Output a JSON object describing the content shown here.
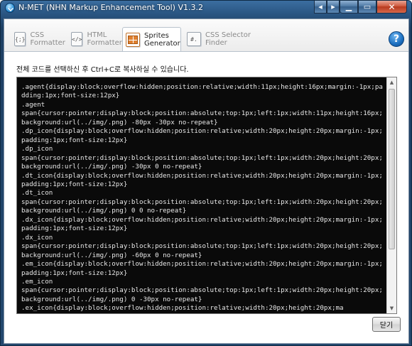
{
  "window": {
    "title": "N-MET (NHN Markup Enhancement Tool) V1.3.2",
    "controls": {
      "back": "◂",
      "forward": "▸",
      "minimize": "▁",
      "maximize": "▭",
      "close": "✕"
    }
  },
  "tabs": [
    {
      "label": "CSS\nFormatter",
      "icon": "css-formatter-icon",
      "glyph": "{;}",
      "active": false
    },
    {
      "label": "HTML\nFormatter",
      "icon": "html-formatter-icon",
      "glyph": "</>",
      "active": false
    },
    {
      "label": "Sprites\nGenerator",
      "icon": "sprites-generator-icon",
      "glyph": "",
      "active": true
    },
    {
      "label": "CSS Selector\nFinder",
      "icon": "css-selector-finder-icon",
      "glyph": "#.",
      "active": false
    }
  ],
  "help": {
    "label": "?"
  },
  "panel": {
    "instruction": "전체 코드를 선택하신 후 Ctrl+C로 복사하실 수 있습니다.",
    "code": ".agent{display:block;overflow:hidden;position:relative;width:11px;height:16px;margin:-1px;padding:1px;font-size:12px}\n.agent\nspan{cursor:pointer;display:block;position:absolute;top:1px;left:1px;width:11px;height:16px;background:url(../img/.png) -80px -30px no-repeat}\n.dp_icon{display:block;overflow:hidden;position:relative;width:20px;height:20px;margin:-1px;padding:1px;font-size:12px}\n.dp_icon\nspan{cursor:pointer;display:block;position:absolute;top:1px;left:1px;width:20px;height:20px;background:url(../img/.png) -30px 0 no-repeat}\n.dt_icon{display:block;overflow:hidden;position:relative;width:20px;height:20px;margin:-1px;padding:1px;font-size:12px}\n.dt_icon\nspan{cursor:pointer;display:block;position:absolute;top:1px;left:1px;width:20px;height:20px;background:url(../img/.png) 0 0 no-repeat}\n.dx_icon{display:block;overflow:hidden;position:relative;width:20px;height:20px;margin:-1px;padding:1px;font-size:12px}\n.dx_icon\nspan{cursor:pointer;display:block;position:absolute;top:1px;left:1px;width:20px;height:20px;background:url(../img/.png) -60px 0 no-repeat}\n.em_icon{display:block;overflow:hidden;position:relative;width:20px;height:20px;margin:-1px;padding:1px;font-size:12px}\n.em_icon\nspan{cursor:pointer;display:block;position:absolute;top:1px;left:1px;width:20px;height:20px;background:url(../img/.png) 0 -30px no-repeat}\n.ex_icon{display:block;overflow:hidden;position:relative;width:20px;height:20px;ma",
    "close_button": "닫기"
  },
  "scrollbar": {
    "up": "▲",
    "down": "▼"
  }
}
